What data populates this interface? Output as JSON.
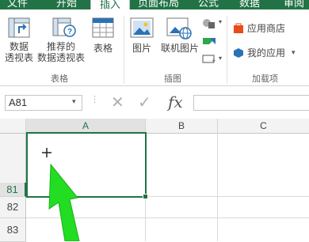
{
  "tabs": [
    "文件",
    "开始",
    "插入",
    "页面布局",
    "公式",
    "数据",
    "审阅"
  ],
  "ribbon": {
    "pivot_table": "数据\n透视表",
    "recommended_pivot": "推荐的\n数据透视表",
    "table": "表格",
    "group_tables": "表格",
    "picture": "图片",
    "online_picture": "联机图片",
    "group_illustrations": "插图",
    "app_store": "应用商店",
    "my_apps": "我的应用",
    "group_addins": "加载项"
  },
  "formula": {
    "name_box": "A81",
    "cancel": "✕",
    "enter": "✓",
    "fx": "fx"
  },
  "columns": [
    "A",
    "B",
    "C"
  ],
  "rows": [
    "81",
    "82",
    "83"
  ],
  "colors": {
    "accent": "#217346",
    "selection": "#217346",
    "arrow": "#22dd22"
  }
}
